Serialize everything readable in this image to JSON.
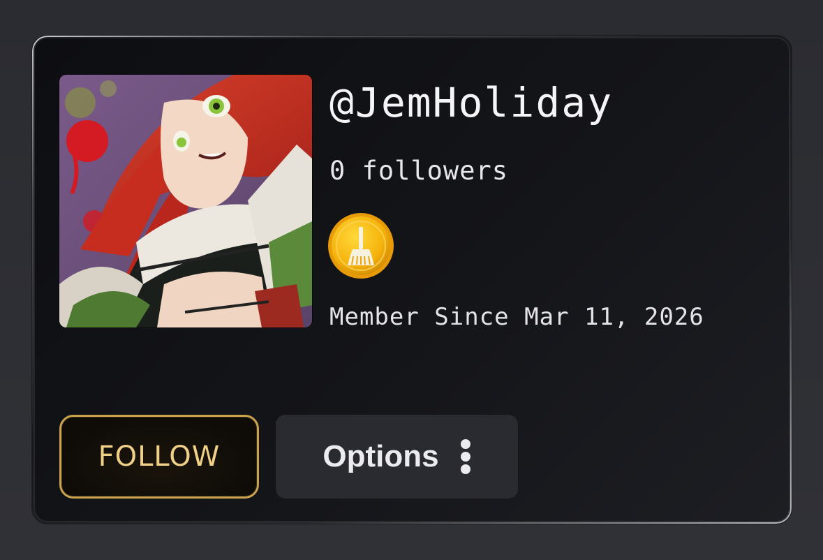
{
  "profile": {
    "username": "@JemHoliday",
    "followers_text": "0 followers",
    "member_since": "Member Since Mar 11, 2026",
    "avatar_icon": "anime-character-avatar",
    "badge_icon": "gold-broom-coin-icon"
  },
  "actions": {
    "follow_label": "FOLLOW",
    "options_label": "Options",
    "options_icon": "kebab-menu-icon"
  },
  "colors": {
    "background": "#2e2f34",
    "card": "#121317",
    "follow_gold": "#c9a24e",
    "options_bg": "#2a2b30",
    "coin_gold": "#f5b90a"
  }
}
